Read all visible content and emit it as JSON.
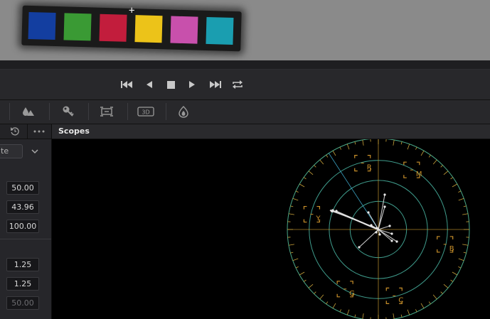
{
  "viewer": {
    "color_patches": [
      "#133ea0",
      "#3a9a34",
      "#c21d3c",
      "#ecc319",
      "#c850ac",
      "#1a9eb0"
    ],
    "crosshair": "+"
  },
  "transport": {
    "buttons": [
      {
        "name": "skip-to-start",
        "glyph": "⏮"
      },
      {
        "name": "previous-frame",
        "glyph": "◀"
      },
      {
        "name": "stop",
        "glyph": "■"
      },
      {
        "name": "play",
        "glyph": "▶"
      },
      {
        "name": "skip-to-end",
        "glyph": "⏭"
      },
      {
        "name": "loop",
        "glyph": "⇄"
      }
    ]
  },
  "toolbar": {
    "icons": [
      "qualifier-icon",
      "key-icon",
      "sizing-icon",
      "3d-icon",
      "fx-icon"
    ],
    "label_3d": "3D"
  },
  "left_panel": {
    "dropdown_text": "te",
    "fields_group1": [
      "50.00",
      "43.96",
      "100.00"
    ],
    "fields_group2": [
      "1.25",
      "1.25",
      "50.00"
    ]
  },
  "scopes_panel": {
    "title": "Scopes",
    "vectorscope": {
      "targets": [
        {
          "label": "R",
          "angle": 103.4
        },
        {
          "label": "M",
          "angle": 60.8
        },
        {
          "label": "B",
          "angle": -12.6
        },
        {
          "label": "C",
          "angle": -76.6
        },
        {
          "label": "G",
          "angle": -119.2
        },
        {
          "label": "Y",
          "angle": 167.1
        }
      ],
      "colors": {
        "graticule": "#3f9c8c",
        "target": "#c9902a",
        "trace": "#e8e8e8"
      }
    }
  }
}
